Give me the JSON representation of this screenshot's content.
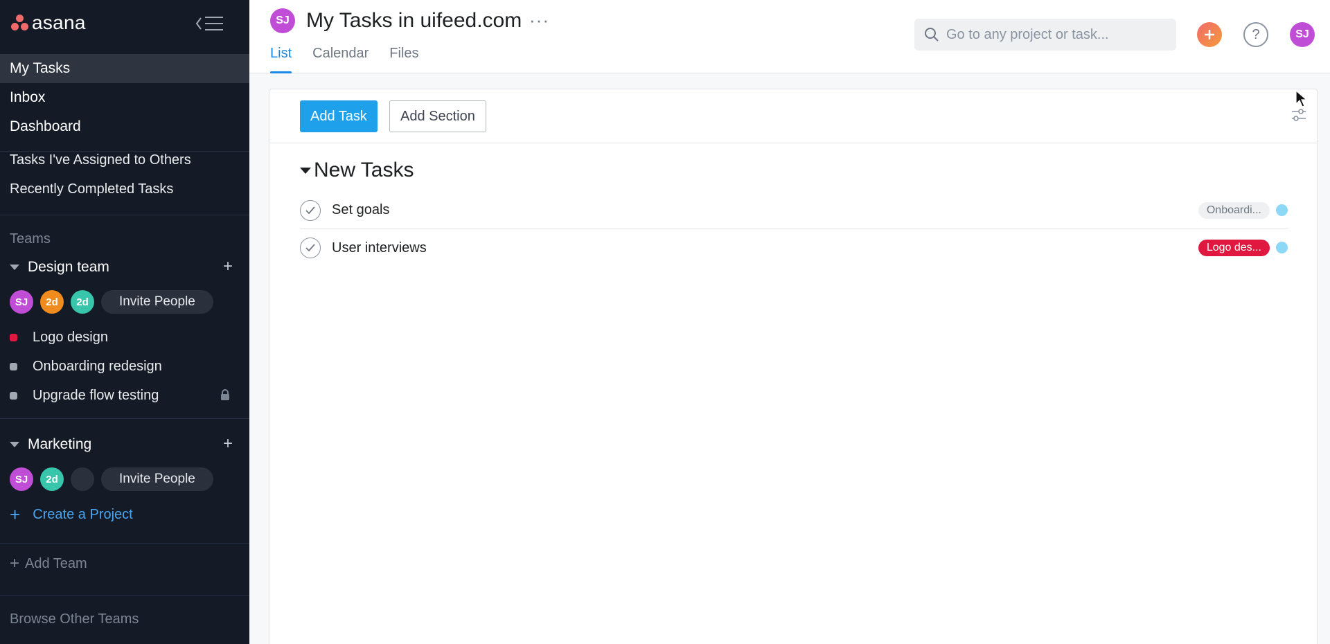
{
  "sidebar": {
    "logo_text": "asana",
    "nav": [
      "My Tasks",
      "Inbox",
      "Dashboard"
    ],
    "nav_secondary": [
      "Tasks I've Assigned to Others",
      "Recently Completed Tasks"
    ],
    "teams_label": "Teams",
    "teams": [
      {
        "name": "Design team",
        "members": [
          {
            "initials": "SJ",
            "color": "#c04dd6"
          },
          {
            "initials": "2d",
            "color": "#f08b1d"
          },
          {
            "initials": "2d",
            "color": "#37c5ab"
          }
        ],
        "invite_label": "Invite People",
        "projects": [
          {
            "name": "Logo design",
            "color": "#e0173e"
          },
          {
            "name": "Onboarding redesign",
            "color": "#a2a8b1"
          },
          {
            "name": "Upgrade flow testing",
            "color": "#a2a8b1",
            "locked": true
          }
        ]
      },
      {
        "name": "Marketing",
        "members": [
          {
            "initials": "SJ",
            "color": "#c04dd6"
          },
          {
            "initials": "2d",
            "color": "#37c5ab"
          },
          {
            "initials": "",
            "color": "#2a313c"
          }
        ],
        "invite_label": "Invite People",
        "projects": []
      }
    ],
    "create_project": "Create a Project",
    "add_team": "Add Team",
    "browse_teams": "Browse Other Teams"
  },
  "header": {
    "avatar_initials": "SJ",
    "title": "My Tasks in uifeed.com",
    "more": "···",
    "tabs": [
      "List",
      "Calendar",
      "Files"
    ],
    "active_tab": "List",
    "search_placeholder": "Go to any project or task...",
    "help": "?",
    "user_initials": "SJ"
  },
  "toolbar": {
    "add_task": "Add Task",
    "add_section": "Add Section"
  },
  "section": {
    "title": "New Tasks",
    "tasks": [
      {
        "name": "Set goals",
        "tag": "Onboardi...",
        "tag_style": "grey"
      },
      {
        "name": "User interviews",
        "tag": "Logo des...",
        "tag_style": "red"
      }
    ]
  }
}
